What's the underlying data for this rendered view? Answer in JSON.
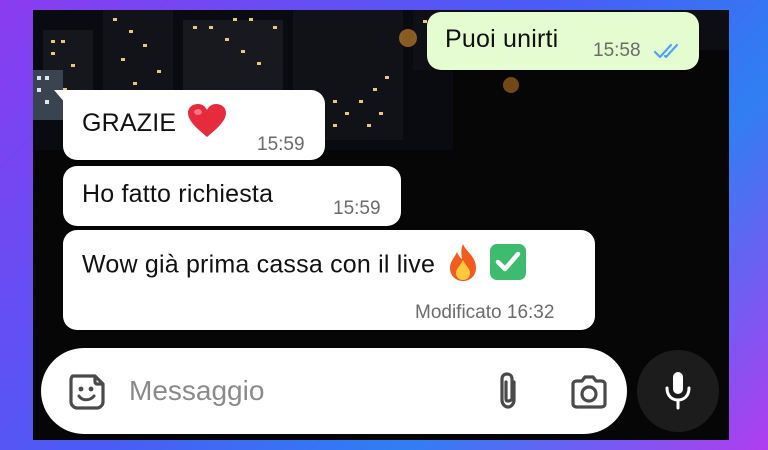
{
  "messages": [
    {
      "direction": "outgoing",
      "text": "Puoi unirti",
      "time": "15:58",
      "status_icon": "double-check-read-icon"
    },
    {
      "direction": "incoming",
      "text": "GRAZIE",
      "emoji": "red-heart",
      "time": "15:59"
    },
    {
      "direction": "incoming",
      "text": "Ho fatto richiesta",
      "time": "15:59"
    },
    {
      "direction": "incoming",
      "text": "Wow già prima cassa con il live",
      "emoji": "fire, check-mark-button",
      "time": "Modificato 16:32"
    }
  ],
  "composer": {
    "placeholder": "Messaggio",
    "sticker_icon": "sticker-icon",
    "attach_icon": "paperclip-icon",
    "camera_icon": "camera-icon",
    "mic_icon": "microphone-icon"
  },
  "colors": {
    "outgoing_bubble": "#e4fcd0",
    "incoming_bubble": "#ffffff",
    "read_ticks": "#4fa3f7",
    "mic_button": "#1c1c1c"
  }
}
